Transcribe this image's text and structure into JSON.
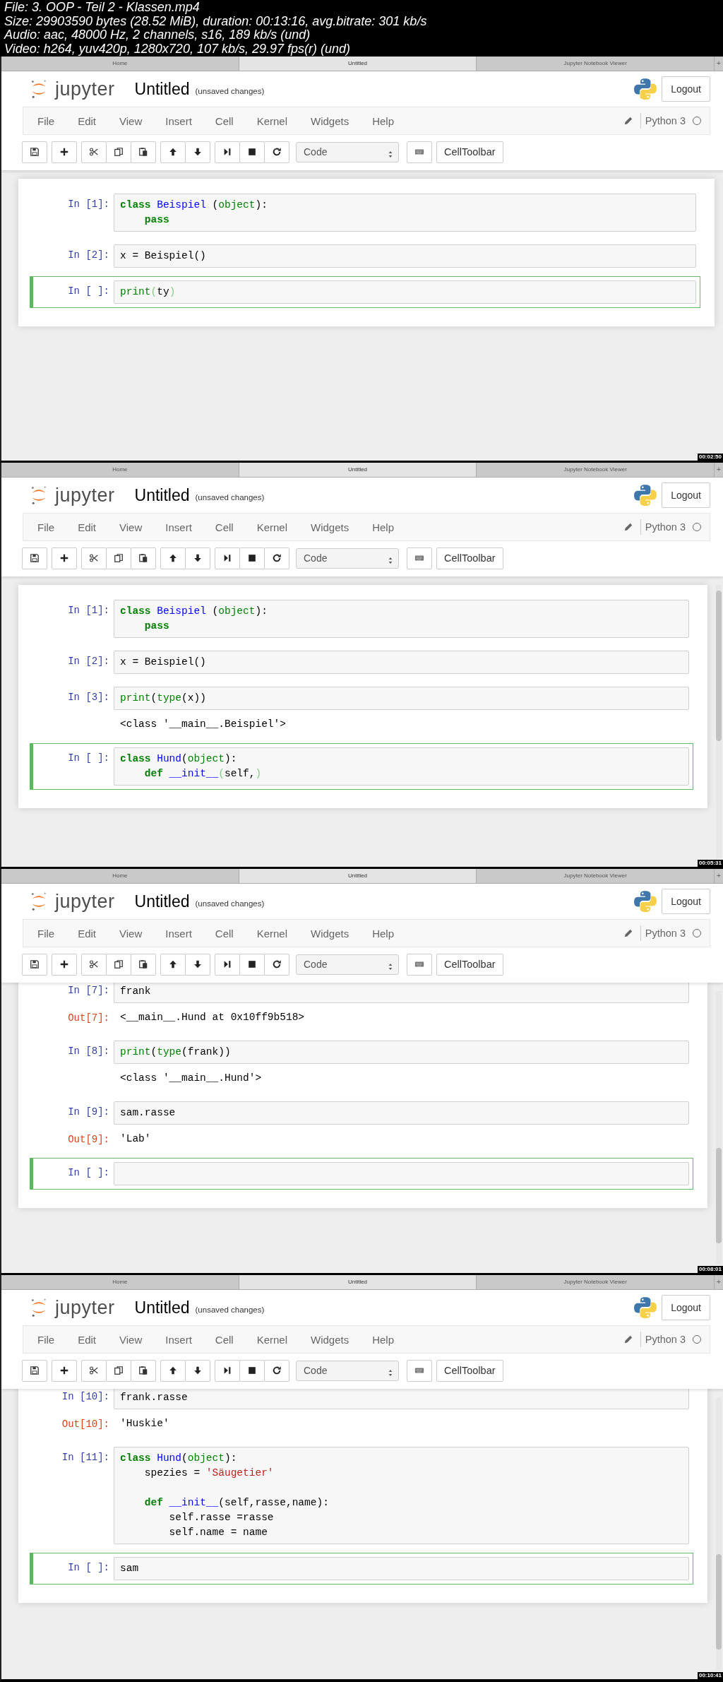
{
  "file_info": [
    "File: 3. OOP - Teil 2 - Klassen.mp4",
    "Size: 29903590 bytes (28.52 MiB), duration: 00:13:16, avg.bitrate: 301 kb/s",
    "Audio: aac, 48000 Hz, 2 channels, s16, 189 kb/s (und)",
    "Video: h264, yuv420p, 1280x720, 107 kb/s, 29.97 fps(r) (und)"
  ],
  "frames": [
    {
      "tabs": [
        {
          "label": "Home",
          "selected": false
        },
        {
          "label": "Untitled",
          "selected": true
        },
        {
          "label": "Jupyter Notebook Viewer",
          "selected": false
        }
      ],
      "new_tab": "+",
      "logo_text": "jupyter",
      "title": "Untitled",
      "save_status": "(unsaved changes)",
      "logout": "Logout",
      "menu": [
        "File",
        "Edit",
        "View",
        "Insert",
        "Cell",
        "Kernel",
        "Widgets",
        "Help"
      ],
      "kernel": "Python 3",
      "cell_type": "Code",
      "cell_toolbar": "CellToolbar",
      "scrolled": false,
      "scrollbar": false,
      "timestamp": "00:02:50",
      "cells": [
        {
          "prompt": "In [1]:",
          "selected": false,
          "lines": [
            {
              "kind": "code",
              "tokens": [
                {
                  "kind": "kw",
                  "text": "class"
                },
                {
                  "kind": "name",
                  "text": " Beispiel"
                },
                {
                  "kind": "p",
                  "text": " ("
                },
                {
                  "kind": "bi",
                  "text": "object"
                },
                {
                  "kind": "p",
                  "text": "):"
                }
              ]
            },
            {
              "kind": "code",
              "tokens": [
                {
                  "kind": "kw",
                  "text": "    pass"
                }
              ]
            }
          ]
        },
        {
          "prompt": "In [2]:",
          "selected": false,
          "lines": [
            {
              "kind": "code",
              "tokens": [
                {
                  "kind": "p",
                  "text": "x = Beispiel()"
                }
              ]
            }
          ]
        },
        {
          "prompt": "In [ ]:",
          "selected": true,
          "lines": [
            {
              "kind": "code",
              "tokens": [
                {
                  "kind": "bi",
                  "text": "print"
                },
                {
                  "kind": "match",
                  "text": "("
                },
                {
                  "kind": "p",
                  "text": "ty"
                },
                {
                  "kind": "match",
                  "text": ")"
                }
              ]
            }
          ]
        }
      ]
    },
    {
      "tabs": [
        {
          "label": "Home",
          "selected": false
        },
        {
          "label": "Untitled",
          "selected": true
        },
        {
          "label": "Jupyter Notebook Viewer",
          "selected": false
        }
      ],
      "new_tab": "+",
      "logo_text": "jupyter",
      "title": "Untitled",
      "save_status": "(unsaved changes)",
      "logout": "Logout",
      "menu": [
        "File",
        "Edit",
        "View",
        "Insert",
        "Cell",
        "Kernel",
        "Widgets",
        "Help"
      ],
      "kernel": "Python 3",
      "cell_type": "Code",
      "cell_toolbar": "CellToolbar",
      "scrolled": false,
      "scrollbar": true,
      "timestamp": "00:05:31",
      "cells": [
        {
          "prompt": "In [1]:",
          "selected": false,
          "lines": [
            {
              "kind": "code",
              "tokens": [
                {
                  "kind": "kw",
                  "text": "class"
                },
                {
                  "kind": "name",
                  "text": " Beispiel"
                },
                {
                  "kind": "p",
                  "text": " ("
                },
                {
                  "kind": "bi",
                  "text": "object"
                },
                {
                  "kind": "p",
                  "text": "):"
                }
              ]
            },
            {
              "kind": "code",
              "tokens": [
                {
                  "kind": "kw",
                  "text": "    pass"
                }
              ]
            }
          ]
        },
        {
          "prompt": "In [2]:",
          "selected": false,
          "lines": [
            {
              "kind": "code",
              "tokens": [
                {
                  "kind": "p",
                  "text": "x = Beispiel()"
                }
              ]
            }
          ]
        },
        {
          "prompt": "In [3]:",
          "selected": false,
          "lines": [
            {
              "kind": "code",
              "tokens": [
                {
                  "kind": "bi",
                  "text": "print"
                },
                {
                  "kind": "p",
                  "text": "("
                },
                {
                  "kind": "bi",
                  "text": "type"
                },
                {
                  "kind": "p",
                  "text": "(x))"
                }
              ]
            }
          ],
          "output": "<class '__main__.Beispiel'>"
        },
        {
          "prompt": "In [ ]:",
          "selected": true,
          "lines": [
            {
              "kind": "code",
              "tokens": [
                {
                  "kind": "kw",
                  "text": "class"
                },
                {
                  "kind": "name",
                  "text": " Hund"
                },
                {
                  "kind": "p",
                  "text": "("
                },
                {
                  "kind": "bi",
                  "text": "object"
                },
                {
                  "kind": "p",
                  "text": "):"
                }
              ]
            },
            {
              "kind": "code",
              "tokens": [
                {
                  "kind": "kw",
                  "text": "    def"
                },
                {
                  "kind": "name",
                  "text": " __init__"
                },
                {
                  "kind": "match",
                  "text": "("
                },
                {
                  "kind": "p",
                  "text": "self,"
                },
                {
                  "kind": "match",
                  "text": ")"
                }
              ]
            }
          ]
        }
      ]
    },
    {
      "tabs": [
        {
          "label": "Home",
          "selected": false
        },
        {
          "label": "Untitled",
          "selected": true
        },
        {
          "label": "Jupyter Notebook Viewer",
          "selected": false
        }
      ],
      "new_tab": "+",
      "logo_text": "jupyter",
      "title": "Untitled",
      "save_status": "(unsaved changes)",
      "logout": "Logout",
      "menu": [
        "File",
        "Edit",
        "View",
        "Insert",
        "Cell",
        "Kernel",
        "Widgets",
        "Help"
      ],
      "kernel": "Python 3",
      "cell_type": "Code",
      "cell_toolbar": "CellToolbar",
      "scrolled": true,
      "scrollbar": true,
      "timestamp": "00:08:01",
      "cells": [
        {
          "prompt": "In [7]:",
          "selected": false,
          "lines": [
            {
              "kind": "code",
              "tokens": [
                {
                  "kind": "p",
                  "text": "frank"
                }
              ]
            }
          ],
          "output_prompt": "Out[7]:",
          "output": "<__main__.Hund at 0x10ff9b518>"
        },
        {
          "prompt": "In [8]:",
          "selected": false,
          "lines": [
            {
              "kind": "code",
              "tokens": [
                {
                  "kind": "bi",
                  "text": "print"
                },
                {
                  "kind": "p",
                  "text": "("
                },
                {
                  "kind": "bi",
                  "text": "type"
                },
                {
                  "kind": "p",
                  "text": "(frank))"
                }
              ]
            }
          ],
          "output": "<class '__main__.Hund'>"
        },
        {
          "prompt": "In [9]:",
          "selected": false,
          "lines": [
            {
              "kind": "code",
              "tokens": [
                {
                  "kind": "p",
                  "text": "sam.rasse"
                }
              ]
            }
          ],
          "output_prompt": "Out[9]:",
          "output": "'Lab'"
        },
        {
          "prompt": "In [ ]:",
          "selected": true,
          "lines": [
            {
              "kind": "blank"
            }
          ]
        }
      ]
    },
    {
      "tabs": [
        {
          "label": "Home",
          "selected": false
        },
        {
          "label": "Untitled",
          "selected": true
        },
        {
          "label": "Jupyter Notebook Viewer",
          "selected": false
        }
      ],
      "new_tab": "+",
      "logo_text": "jupyter",
      "title": "Untitled",
      "save_status": "(unsaved changes)",
      "logout": "Logout",
      "menu": [
        "File",
        "Edit",
        "View",
        "Insert",
        "Cell",
        "Kernel",
        "Widgets",
        "Help"
      ],
      "kernel": "Python 3",
      "cell_type": "Code",
      "cell_toolbar": "CellToolbar",
      "scrolled": true,
      "scrollbar": true,
      "timestamp": "00:10:41",
      "cells": [
        {
          "prompt": "In [10]:",
          "selected": false,
          "lines": [
            {
              "kind": "code",
              "tokens": [
                {
                  "kind": "p",
                  "text": "frank.rasse"
                }
              ]
            }
          ],
          "output_prompt": "Out[10]:",
          "output": "'Huskie'"
        },
        {
          "prompt": "In [11]:",
          "selected": false,
          "lines": [
            {
              "kind": "code",
              "tokens": [
                {
                  "kind": "kw",
                  "text": "class"
                },
                {
                  "kind": "name",
                  "text": " Hund"
                },
                {
                  "kind": "p",
                  "text": "("
                },
                {
                  "kind": "bi",
                  "text": "object"
                },
                {
                  "kind": "p",
                  "text": "):"
                }
              ]
            },
            {
              "kind": "code",
              "tokens": [
                {
                  "kind": "p",
                  "text": "    spezies = "
                },
                {
                  "kind": "str",
                  "text": "'Säugetier'"
                }
              ]
            },
            {
              "kind": "blank"
            },
            {
              "kind": "code",
              "tokens": [
                {
                  "kind": "kw",
                  "text": "    def"
                },
                {
                  "kind": "name",
                  "text": " __init__"
                },
                {
                  "kind": "p",
                  "text": "(self,rasse,name):"
                }
              ]
            },
            {
              "kind": "code",
              "tokens": [
                {
                  "kind": "p",
                  "text": "        self.rasse =rasse"
                }
              ]
            },
            {
              "kind": "code",
              "tokens": [
                {
                  "kind": "p",
                  "text": "        self.name = name"
                }
              ]
            }
          ]
        },
        {
          "prompt": "In [ ]:",
          "selected": true,
          "lines": [
            {
              "kind": "code",
              "tokens": [
                {
                  "kind": "p",
                  "text": "sam"
                }
              ]
            }
          ]
        }
      ]
    }
  ]
}
